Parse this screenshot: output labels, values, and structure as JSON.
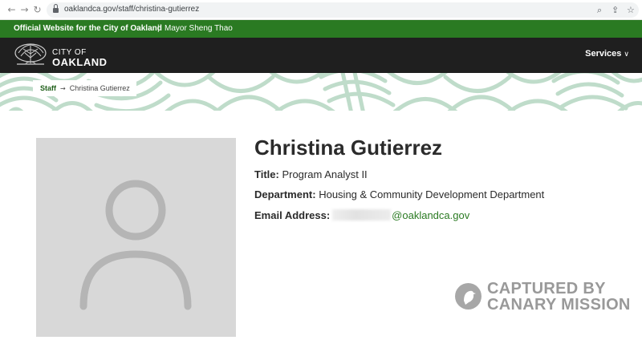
{
  "browser": {
    "url": "oaklandca.gov/staff/christina-gutierrez",
    "back_icon": "arrow-left-icon",
    "forward_icon": "arrow-right-icon",
    "reload_icon": "reload-icon"
  },
  "official_bar": {
    "title": "Official Website for the City of Oakland",
    "separator": "|",
    "mayor": "Mayor Sheng Thao",
    "color": "#2a7a22"
  },
  "header": {
    "logo_line1": "CITY OF",
    "logo_line2": "OAKLAND",
    "services_label": "Services",
    "background": "#1f1f1f"
  },
  "breadcrumb": {
    "root": "Staff",
    "arrow": "→",
    "current": "Christina Gutierrez"
  },
  "profile": {
    "name": "Christina Gutierrez",
    "title_label": "Title:",
    "title_value": "Program Analyst II",
    "department_label": "Department:",
    "department_value": "Housing & Community Development Department",
    "email_label": "Email Address:",
    "email_domain": "@oaklandca.gov",
    "photo_icon": "user-placeholder-icon"
  },
  "watermark": {
    "line1": "CAPTURED BY",
    "line2": "CANARY MISSION"
  }
}
